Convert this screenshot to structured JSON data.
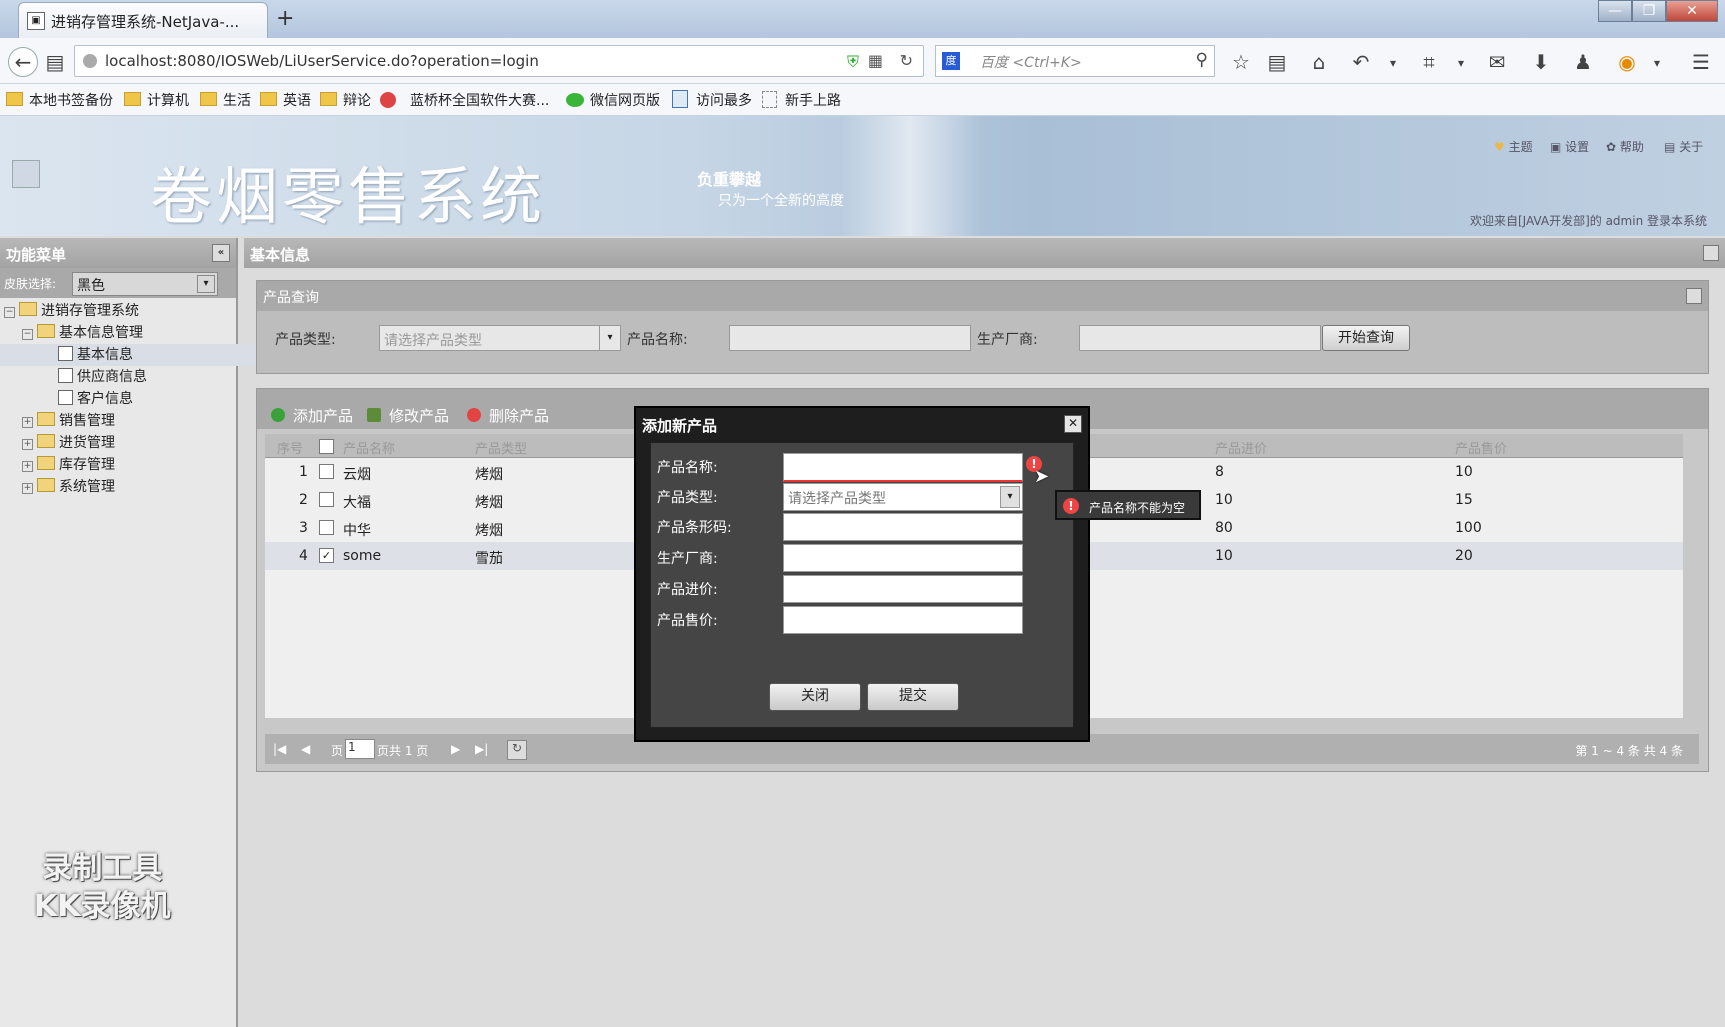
{
  "browser": {
    "tab_title": "进销存管理系统-NetJava-...",
    "new_tab": "+",
    "url": "localhost:8080/IOSWeb/LiUserService.do?operation=login",
    "search_placeholder": "百度 <Ctrl+K>",
    "bookmarks": [
      "本地书签备份",
      "计算机",
      "生活",
      "英语",
      "辩论",
      "蓝桥杯全国软件大赛...",
      "微信网页版",
      "访问最多",
      "新手上路"
    ]
  },
  "header": {
    "app_title": "卷烟零售系统",
    "slogan_main": "负重攀越",
    "slogan_sub": "只为一个全新的高度",
    "links": [
      "主题",
      "设置",
      "帮助",
      "关于"
    ],
    "welcome": "欢迎来自[JAVA开发部]的 admin 登录本系统"
  },
  "sidebar": {
    "title": "功能菜单",
    "skin_label": "皮肤选择:",
    "skin_value": "黑色",
    "tree": {
      "root": "进销存管理系统",
      "basic": "基本信息管理",
      "basic_children": [
        "基本信息",
        "供应商信息",
        "客户信息"
      ],
      "others": [
        "销售管理",
        "进货管理",
        "库存管理",
        "系统管理"
      ]
    }
  },
  "watermark": {
    "line1": "录制工具",
    "line2": "KK录像机"
  },
  "main": {
    "title": "基本信息",
    "query": {
      "title": "产品查询",
      "type_label": "产品类型:",
      "type_placeholder": "请选择产品类型",
      "name_label": "产品名称:",
      "maker_label": "生产厂商:",
      "search_button": "开始查询"
    },
    "toolbar": {
      "add": "添加产品",
      "edit": "修改产品",
      "delete": "删除产品"
    },
    "columns": [
      "序号",
      "产品名称",
      "产品类型",
      "产品进价",
      "产品售价"
    ],
    "rows": [
      {
        "no": "1",
        "name": "云烟",
        "type": "烤烟",
        "buy": "8",
        "sell": "10",
        "checked": false
      },
      {
        "no": "2",
        "name": "大福",
        "type": "烤烟",
        "buy": "10",
        "sell": "15",
        "checked": false
      },
      {
        "no": "3",
        "name": "中华",
        "type": "烤烟",
        "buy": "80",
        "sell": "100",
        "checked": false
      },
      {
        "no": "4",
        "name": "some",
        "type": "雪茄",
        "buy": "10",
        "sell": "20",
        "checked": true
      }
    ],
    "pager": {
      "page_label": "页",
      "page_value": "1",
      "total": "页共 1 页",
      "summary": "第 1 ~ 4 条 共 4 条"
    }
  },
  "dialog": {
    "title": "添加新产品",
    "fields": {
      "name": "产品名称:",
      "type": "产品类型:",
      "barcode": "产品条形码:",
      "maker": "生产厂商:",
      "buy": "产品进价:",
      "sell": "产品售价:"
    },
    "type_placeholder": "请选择产品类型",
    "close_button": "关闭",
    "submit_button": "提交",
    "error_tooltip": "产品名称不能为空"
  },
  "colors": {
    "accent_green": "#3aa23a",
    "accent_red": "#e24444",
    "error": "#e33333"
  }
}
